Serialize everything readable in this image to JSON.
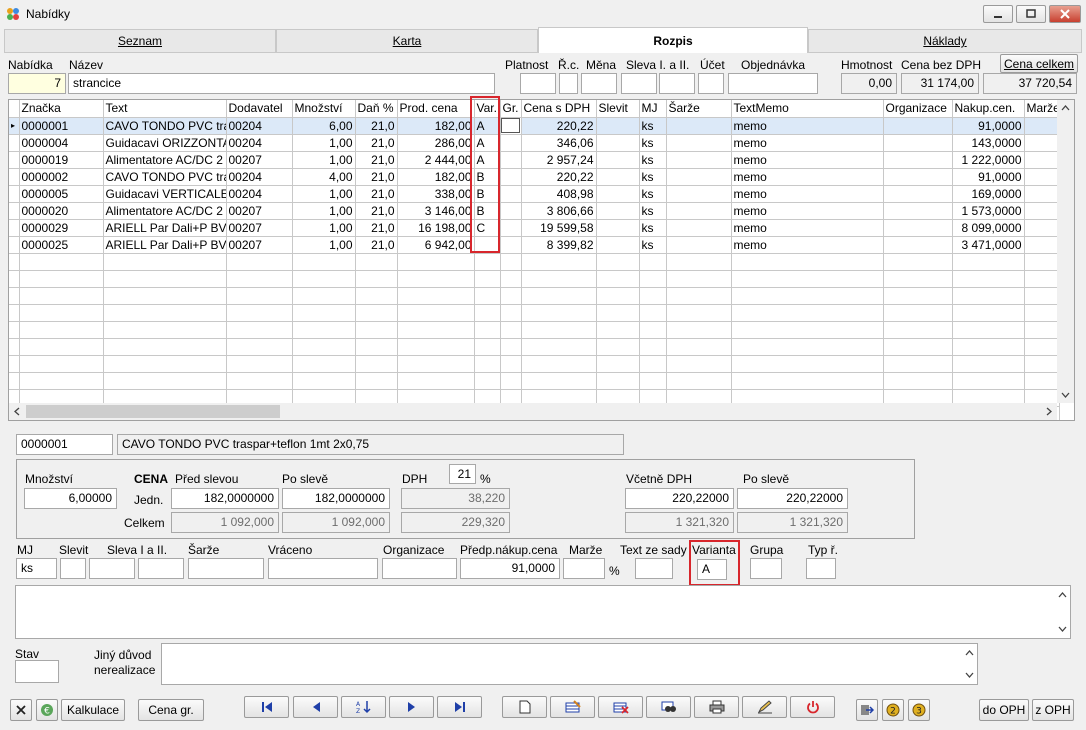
{
  "window": {
    "title": "Nabídky"
  },
  "tabs": [
    {
      "label": "Seznam"
    },
    {
      "label": "Karta"
    },
    {
      "label": "Rozpis"
    },
    {
      "label": "Náklady"
    }
  ],
  "header": {
    "nabidka_label": "Nabídka",
    "nabidka_value": "7",
    "nazev_label": "Název",
    "nazev_value": "strancice",
    "platnost_label": "Platnost",
    "rc_label": "Ř.c.",
    "mena_label": "Měna",
    "sleva_label": "Sleva I. a II.",
    "ucet_label": "Účet",
    "objednavka_label": "Objednávka",
    "hmotnost_label": "Hmotnost",
    "hmotnost_value": "0,00",
    "cena_bez_label": "Cena bez DPH",
    "cena_bez_value": "31 174,00",
    "cena_celkem_label": "Cena celkem",
    "cena_celkem_value": "37 720,54"
  },
  "grid": {
    "columns": [
      "Značka",
      "Text",
      "Dodavatel",
      "Množství",
      "Daň %",
      "Prod. cena",
      "Var.",
      "Gr.",
      "Cena s DPH",
      "Slevit",
      "MJ",
      "Šarže",
      "TextMemo",
      "Organizace",
      "Nakup.cen.",
      "Marže"
    ],
    "rows": [
      [
        "0000001",
        "CAVO TONDO PVC tra",
        "00204",
        "6,00",
        "21,0",
        "182,00",
        "A",
        "",
        "220,22",
        "",
        "ks",
        "",
        "memo",
        "",
        "91,0000",
        ""
      ],
      [
        "0000004",
        "Guidacavi ORIZZONTA",
        "00204",
        "1,00",
        "21,0",
        "286,00",
        "A",
        "",
        "346,06",
        "",
        "ks",
        "",
        "memo",
        "",
        "143,0000",
        ""
      ],
      [
        "0000019",
        "Alimentatore AC/DC 2",
        "00207",
        "1,00",
        "21,0",
        "2 444,00",
        "A",
        "",
        "2 957,24",
        "",
        "ks",
        "",
        "memo",
        "",
        "1 222,0000",
        ""
      ],
      [
        "0000002",
        "CAVO TONDO PVC tra",
        "00204",
        "4,00",
        "21,0",
        "182,00",
        "B",
        "",
        "220,22",
        "",
        "ks",
        "",
        "memo",
        "",
        "91,0000",
        ""
      ],
      [
        "0000005",
        "Guidacavi VERTICALE",
        "00204",
        "1,00",
        "21,0",
        "338,00",
        "B",
        "",
        "408,98",
        "",
        "ks",
        "",
        "memo",
        "",
        "169,0000",
        ""
      ],
      [
        "0000020",
        "Alimentatore AC/DC 2",
        "00207",
        "1,00",
        "21,0",
        "3 146,00",
        "B",
        "",
        "3 806,66",
        "",
        "ks",
        "",
        "memo",
        "",
        "1 573,0000",
        ""
      ],
      [
        "0000029",
        "ARIELL Par Dali+P BV",
        "00207",
        "1,00",
        "21,0",
        "16 198,00",
        "C",
        "",
        "19 599,58",
        "",
        "ks",
        "",
        "memo",
        "",
        "8 099,0000",
        ""
      ],
      [
        "0000025",
        "ARIELL Par Dali+P BV",
        "00207",
        "1,00",
        "21,0",
        "6 942,00",
        "",
        "",
        "8 399,82",
        "",
        "ks",
        "",
        "memo",
        "",
        "3 471,0000",
        ""
      ]
    ]
  },
  "detail": {
    "code": "0000001",
    "name": "CAVO TONDO PVC traspar+teflon 1mt 2x0,75",
    "mnozstvi_label": "Množství",
    "mnozstvi_value": "6,00000",
    "cena_label": "CENA",
    "pred_slevou_label": "Před slevou",
    "po_sleve_label": "Po slevě",
    "dph_label": "DPH",
    "dph_value": "21",
    "pct": "%",
    "vcetne_label": "Včetně DPH",
    "po_sleve2_label": "Po slevě",
    "jedn_label": "Jedn.",
    "celkem_label": "Celkem",
    "jedn_pred": "182,0000000",
    "jedn_po": "182,0000000",
    "jedn_dph": "38,220",
    "jedn_vc": "220,22000",
    "jedn_vc_po": "220,22000",
    "celk_pred": "1 092,000",
    "celk_po": "1 092,000",
    "celk_dph": "229,320",
    "celk_vc": "1 321,320",
    "celk_vc_po": "1 321,320",
    "mj_label": "MJ",
    "mj_value": "ks",
    "slevit_label": "Slevit",
    "sleva_label": "Sleva I a II.",
    "sarze_label": "Šarže",
    "vraceno_label": "Vráceno",
    "organizace_label": "Organizace",
    "predp_label": "Předp.nákup.cena",
    "predp_value": "91,0000",
    "marze_label": "Marže",
    "marze_pct": "%",
    "text_ze_sady_label": "Text ze sady",
    "varianta_label": "Varianta",
    "varianta_value": "A",
    "grupa_label": "Grupa",
    "typ_label": "Typ ř.",
    "stav_label": "Stav",
    "jiny_label1": "Jiný důvod",
    "jiny_label2": "nerealizace"
  },
  "toolbar": {
    "kalkulace": "Kalkulace",
    "cena_gr": "Cena gr.",
    "do_oph": "do OPH",
    "z_oph": "z OPH"
  },
  "colors": {
    "accent_red": "#d8262c",
    "selection": "#dce9f8",
    "yellow_field": "#ffffe0"
  }
}
